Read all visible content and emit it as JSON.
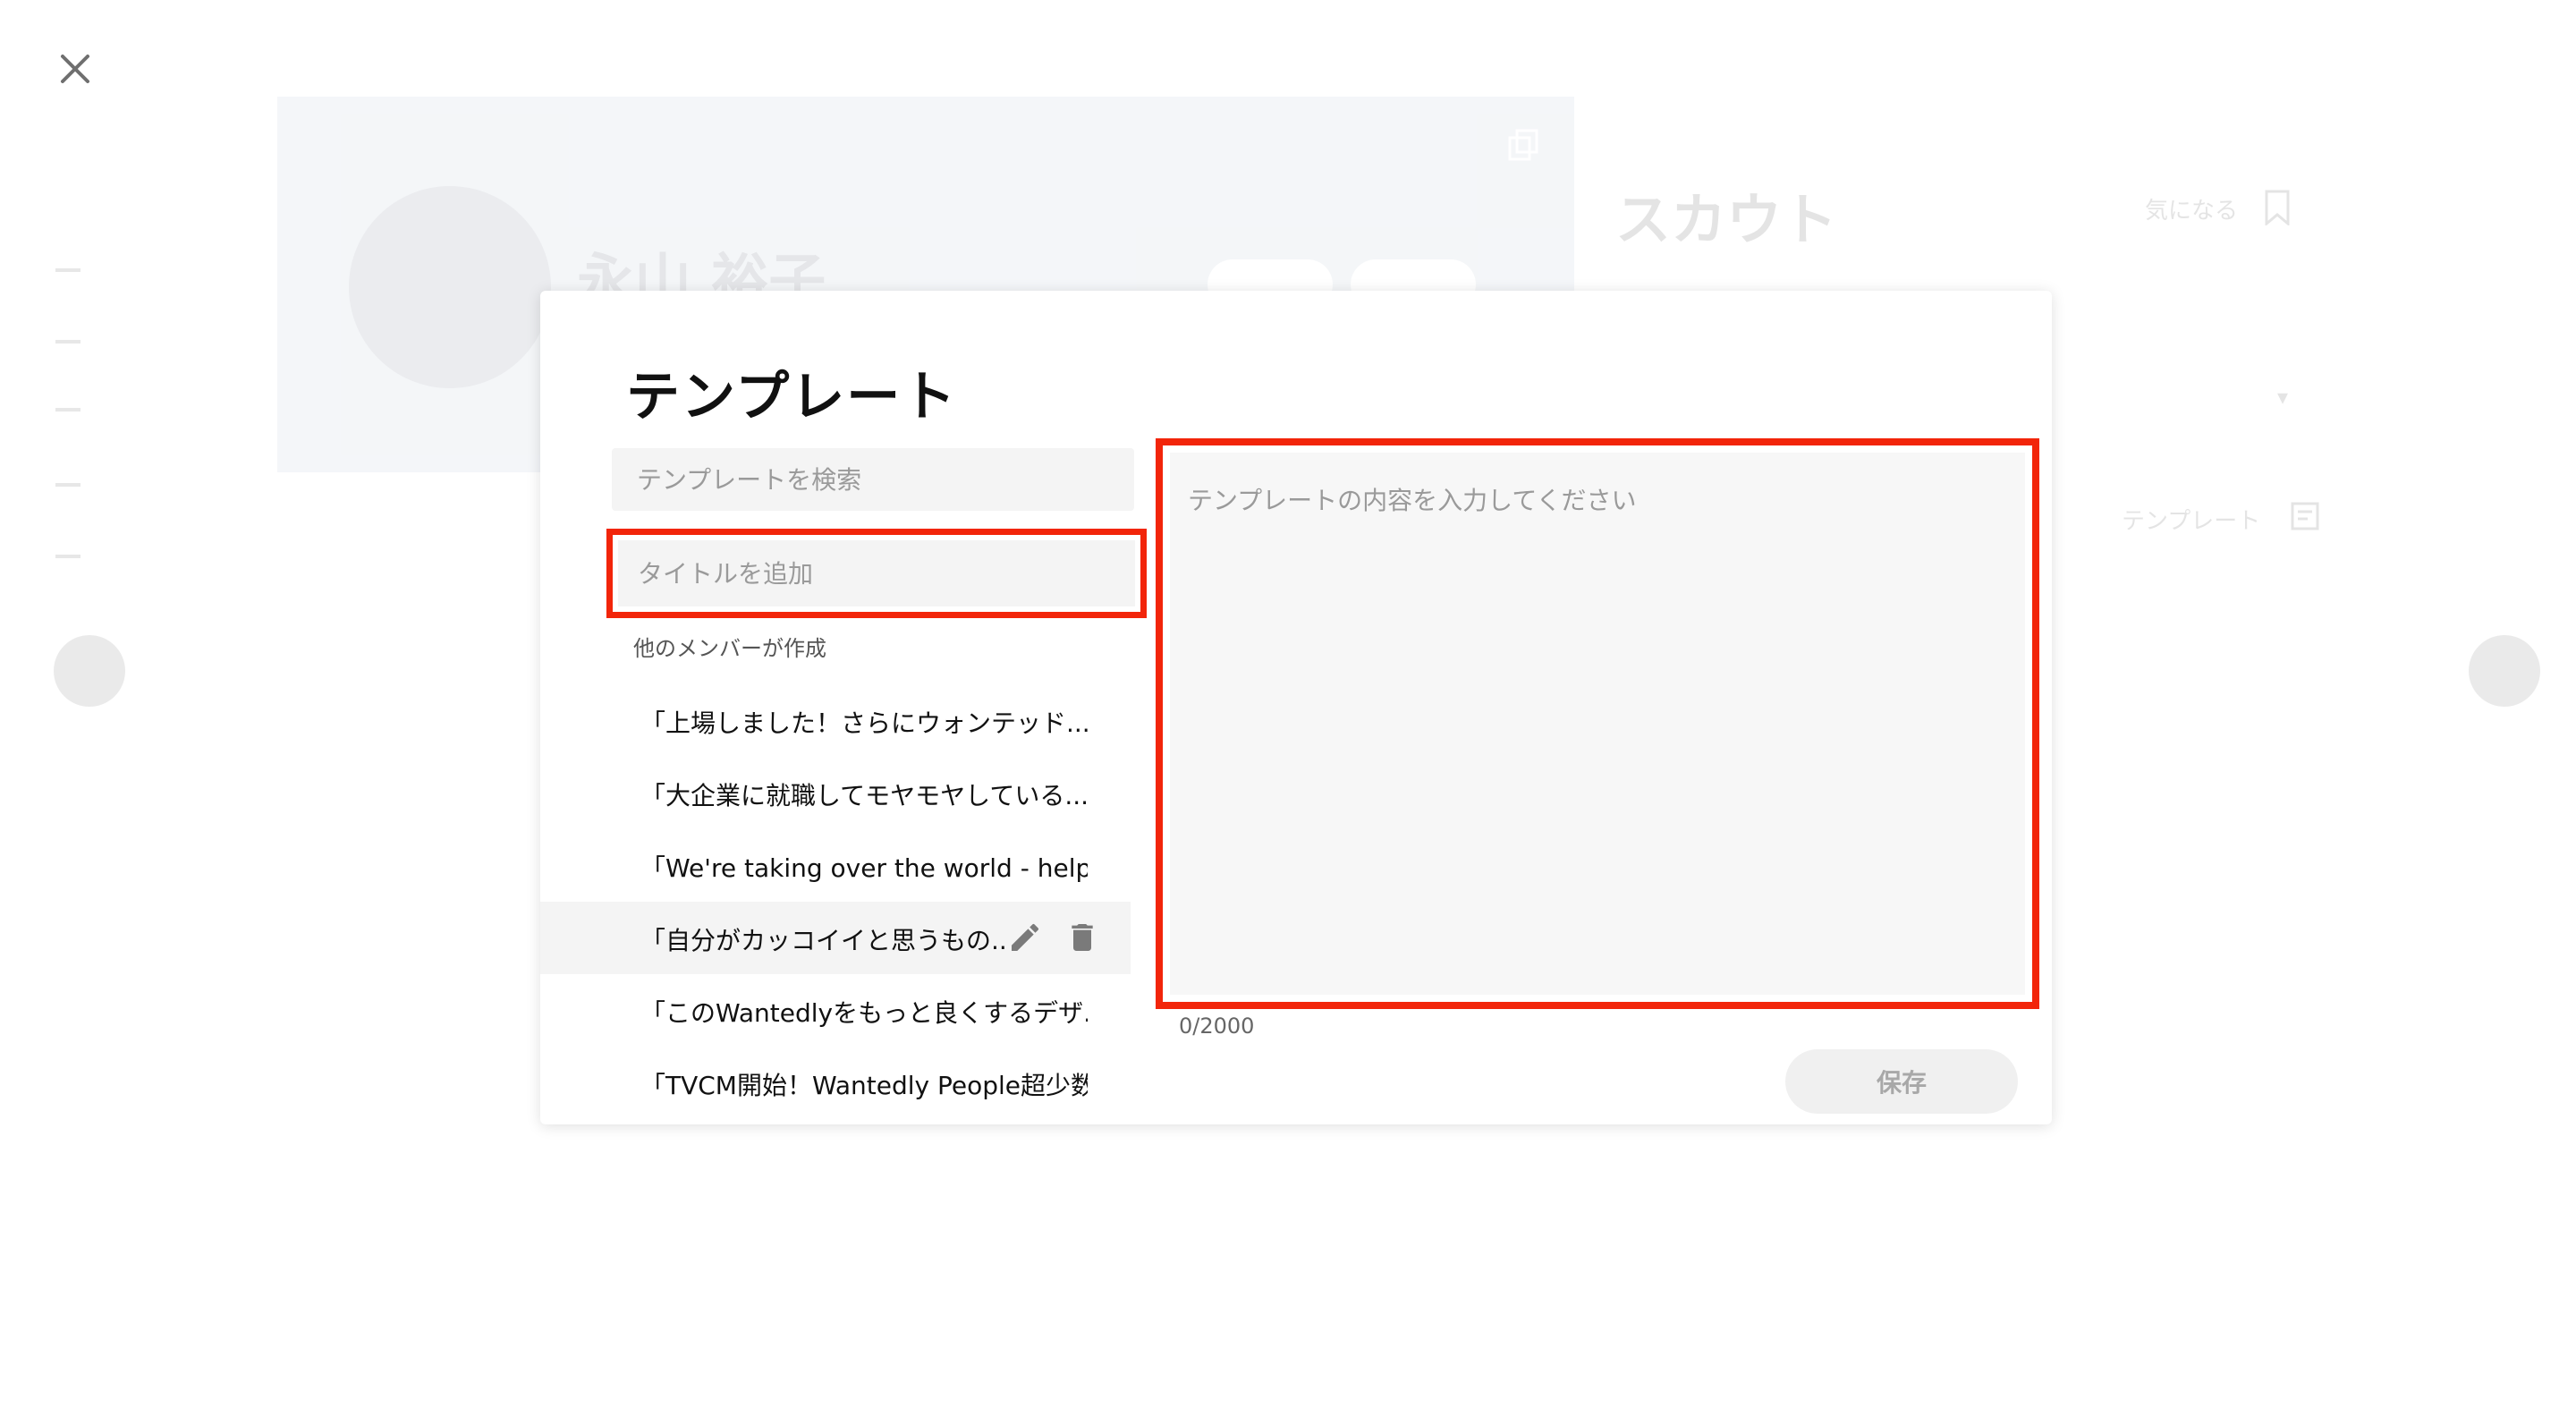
{
  "background": {
    "profile_name": "永山 裕子",
    "scout_title": "スカウト",
    "favorite_label": "気になる",
    "template_label": "テンプレート"
  },
  "modal": {
    "title": "テンプレート",
    "search_placeholder": "テンプレートを検索",
    "title_placeholder": "タイトルを追加",
    "section_label": "他のメンバーが作成",
    "templates": [
      {
        "label": "「上場しました！さらにウォンテッド..."
      },
      {
        "label": "「大企業に就職してモヤモヤしている..."
      },
      {
        "label": "「We're taking over the world - help us c..."
      },
      {
        "label": "「自分がカッコイイと思うもの..."
      },
      {
        "label": "「このWantedlyをもっと良くするデザ..."
      },
      {
        "label": "「TVCM開始！Wantedly People超少数..."
      }
    ],
    "active_index": 3,
    "content_placeholder": "テンプレートの内容を入力してください",
    "char_count": "0/2000",
    "save_label": "保存"
  },
  "colors": {
    "highlight": "#f2250a",
    "input_bg": "#f4f4f4",
    "save_disabled_bg": "#f0f0f0"
  }
}
